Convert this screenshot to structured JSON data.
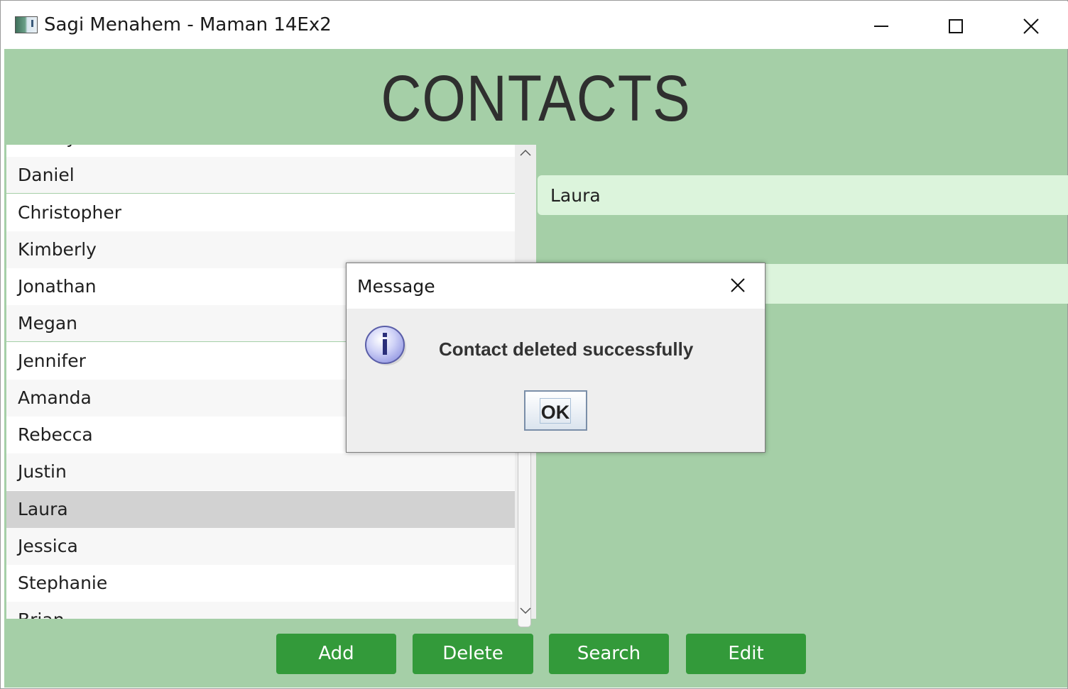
{
  "window": {
    "title": "Sagi Menahem - Maman 14Ex2",
    "icon": "java-app-icon",
    "controls": [
      "minimize-icon",
      "maximize-icon",
      "close-icon"
    ]
  },
  "header": {
    "title": "CONTACTS"
  },
  "contacts": {
    "items": [
      "Ashley",
      "Daniel",
      "Christopher",
      "Kimberly",
      "Jonathan",
      "Megan",
      "Jennifer",
      "Amanda",
      "Rebecca",
      "Justin",
      "Laura",
      "Jessica",
      "Stephanie",
      "Brian"
    ],
    "selected": "Laura"
  },
  "details": {
    "name_value": "Laura",
    "second_value": ""
  },
  "buttons": {
    "add": "Add",
    "delete": "Delete",
    "search": "Search",
    "edit": "Edit"
  },
  "dialog": {
    "title": "Message",
    "message": "Contact deleted successfully",
    "ok_label": "OK",
    "icon": "info-icon"
  },
  "colors": {
    "background": "#a5cfa7",
    "button": "#339a3a",
    "field": "#dcf4dc",
    "selected_row": "#d2d2d2"
  }
}
